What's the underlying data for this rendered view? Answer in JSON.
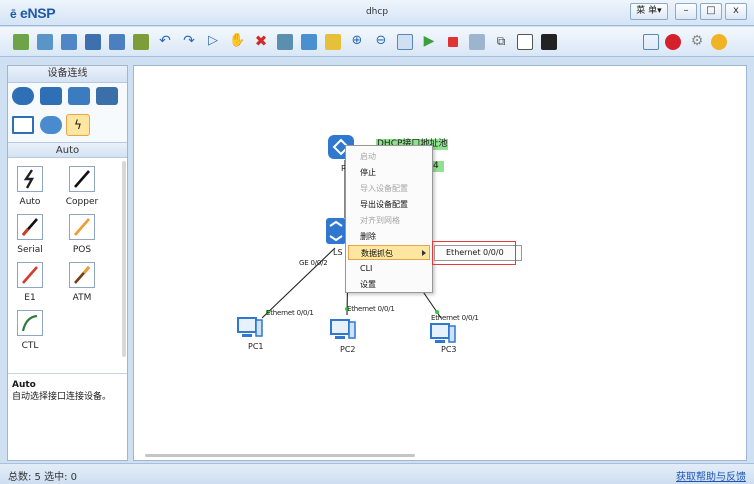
{
  "app": {
    "logo": "eNSP",
    "window_title": "dhcp",
    "menu_label": "菜 单▾",
    "minimize": "–",
    "maximize": "□",
    "close": "x"
  },
  "toolbar": {
    "left_icons": [
      "new-topology",
      "open-topology",
      "save-topology",
      "save-as",
      "print",
      "undo",
      "redo",
      "select",
      "drag",
      "delete",
      "text",
      "palette",
      "device-list",
      "zoom-in",
      "zoom-out",
      "fit",
      "start",
      "stop",
      "capture",
      "topology-view",
      "grid",
      "terminal"
    ],
    "right_icons": [
      "chat",
      "huawei-logo",
      "settings",
      "help"
    ]
  },
  "left_panel": {
    "title": "设备连线",
    "device_icons": [
      "router-icon",
      "switch-icon",
      "wireless-icon",
      "firewall-icon",
      "pc-icon",
      "cloud-icon",
      "connection-icon"
    ],
    "category_label": "Auto",
    "cables": [
      {
        "name": "Auto",
        "color": "#222222"
      },
      {
        "name": "Copper",
        "color": "#111111"
      },
      {
        "name": "Serial",
        "color": "#d33e20"
      },
      {
        "name": "POS",
        "color": "#f09a30"
      },
      {
        "name": "E1",
        "color": "#d63a2a"
      },
      {
        "name": "ATM",
        "color": "#7a3b10"
      },
      {
        "name": "CTL",
        "color": "#2f7d3d"
      }
    ],
    "desc_title": "Auto",
    "desc_text": "自动选择接口连接设备。"
  },
  "canvas": {
    "router_label": "R",
    "switch_label": "LS",
    "pool_tag": "DHCP接口地址池",
    "pool_tag_small": "4",
    "ge_label": "GE 0/0/2",
    "pcs": [
      {
        "name": "PC1",
        "port": "Ethernet 0/0/1"
      },
      {
        "name": "PC2",
        "port": "Ethernet 0/0/1"
      },
      {
        "name": "PC3",
        "port": "Ethernet 0/0/1"
      }
    ]
  },
  "context_menu": {
    "items": [
      {
        "label": "启动",
        "enabled": false
      },
      {
        "label": "停止",
        "enabled": true
      },
      {
        "label": "导入设备配置",
        "enabled": false
      },
      {
        "label": "导出设备配置",
        "enabled": true
      },
      {
        "label": "对齐到网格",
        "enabled": false
      },
      {
        "label": "删除",
        "enabled": true
      },
      {
        "label": "数据抓包",
        "enabled": true,
        "active": true
      },
      {
        "label": "CLI",
        "enabled": true
      },
      {
        "label": "设置",
        "enabled": true
      }
    ],
    "submenu_item": "Ethernet 0/0/0"
  },
  "status": {
    "left": "总数: 5 选中: 0",
    "right": "获取帮助与反馈"
  }
}
